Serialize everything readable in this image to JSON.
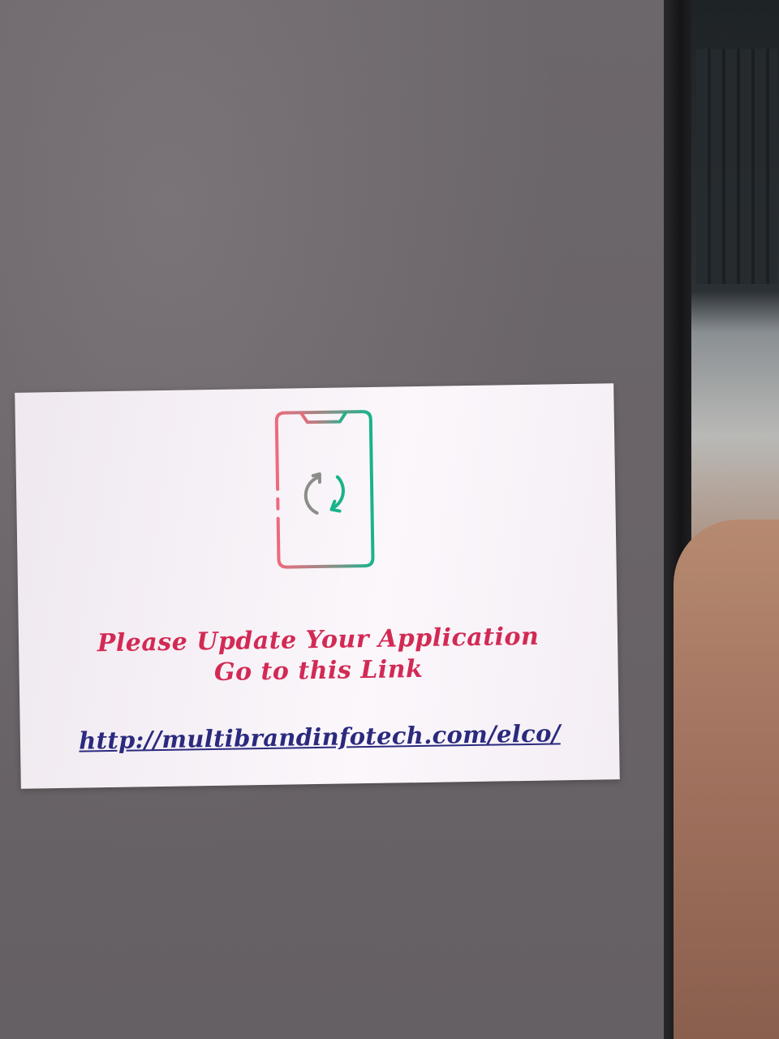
{
  "dialog": {
    "icon": "phone-update-icon",
    "message_line1": "Please Update Your Application",
    "message_line2": "Go to this Link",
    "link_text": "http://multibrandinfotech.com/elco/"
  },
  "colors": {
    "message": "#d22a55",
    "link": "#2b2a7e",
    "icon_left": "#e8707f",
    "icon_right": "#1fb38c"
  }
}
